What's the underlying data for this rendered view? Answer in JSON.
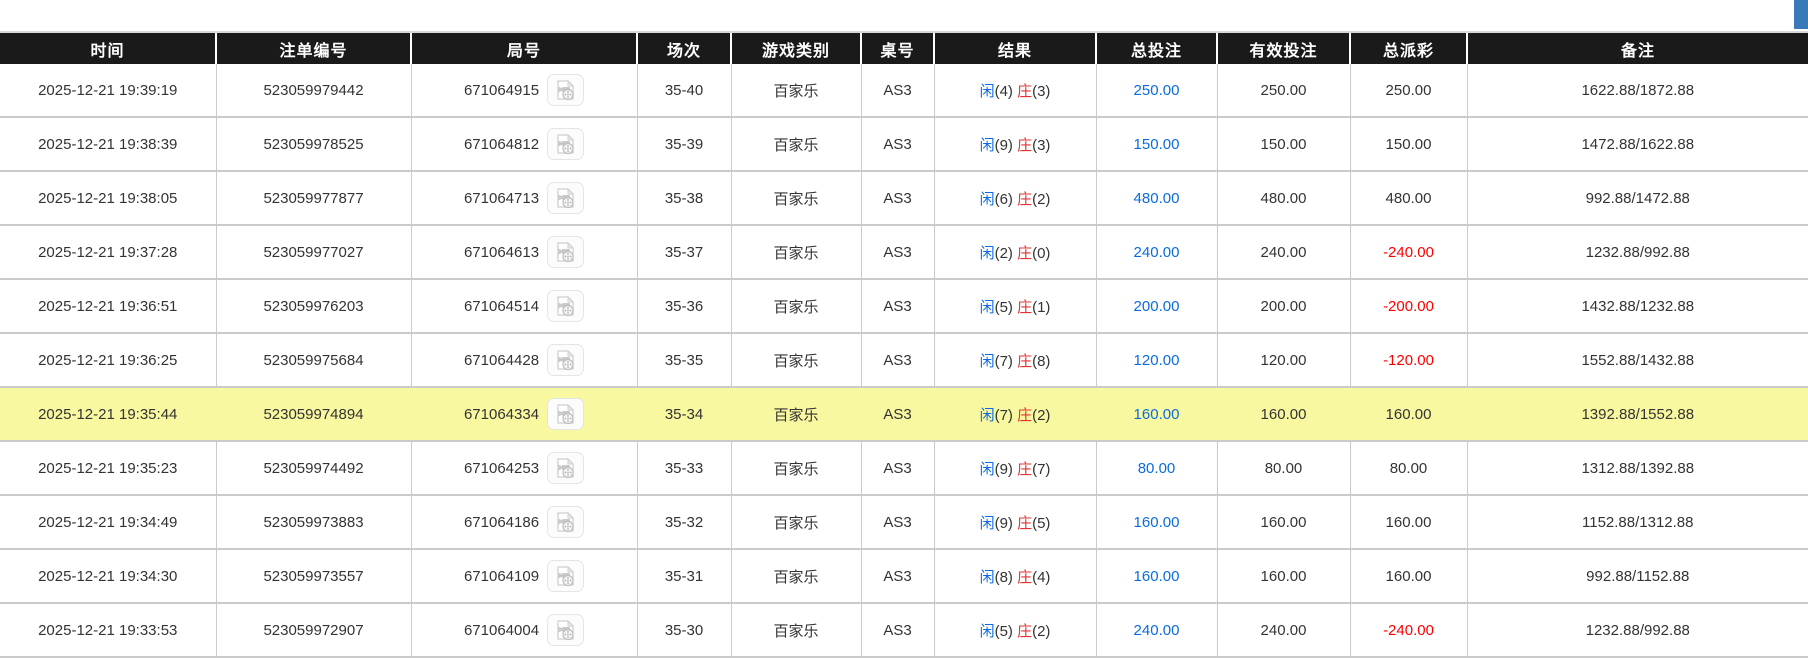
{
  "page": {
    "top_right_fragment": {
      "description": "partially visible blue element at top-right corner",
      "color": "#3a79b8"
    }
  },
  "table": {
    "columns": [
      {
        "key": "time",
        "label": "时间"
      },
      {
        "key": "bet_id",
        "label": "注单编号"
      },
      {
        "key": "round_id",
        "label": "局号"
      },
      {
        "key": "session",
        "label": "场次"
      },
      {
        "key": "game_type",
        "label": "游戏类别"
      },
      {
        "key": "table_no",
        "label": "桌号"
      },
      {
        "key": "result",
        "label": "结果"
      },
      {
        "key": "total_bet",
        "label": "总投注"
      },
      {
        "key": "valid_bet",
        "label": "有效投注"
      },
      {
        "key": "total_payout",
        "label": "总派彩"
      },
      {
        "key": "remark",
        "label": "备注"
      }
    ],
    "labels": {
      "player": "闲",
      "banker": "庄"
    },
    "icons": {
      "round_video": "video-replay-icon"
    },
    "colors": {
      "header_bg": "#1a1a1a",
      "player_blue": "#0a6ce0",
      "banker_red": "#e23333",
      "bet_amount_blue": "#0a6ce0",
      "negative_red": "#ff0000",
      "highlight_yellow": "#f8f8a0",
      "accent_blue": "#3a79b8"
    },
    "rows": [
      {
        "time": "2025-12-21 19:39:19",
        "bet_id": "523059979442",
        "round_id": "671064915",
        "session": "35-40",
        "game_type": "百家乐",
        "table_no": "AS3",
        "player_score": 4,
        "banker_score": 3,
        "total_bet": "250.00",
        "valid_bet": "250.00",
        "total_payout": "250.00",
        "payout_negative": false,
        "remark": "1622.88/1872.88",
        "highlighted": false
      },
      {
        "time": "2025-12-21 19:38:39",
        "bet_id": "523059978525",
        "round_id": "671064812",
        "session": "35-39",
        "game_type": "百家乐",
        "table_no": "AS3",
        "player_score": 9,
        "banker_score": 3,
        "total_bet": "150.00",
        "valid_bet": "150.00",
        "total_payout": "150.00",
        "payout_negative": false,
        "remark": "1472.88/1622.88",
        "highlighted": false
      },
      {
        "time": "2025-12-21 19:38:05",
        "bet_id": "523059977877",
        "round_id": "671064713",
        "session": "35-38",
        "game_type": "百家乐",
        "table_no": "AS3",
        "player_score": 6,
        "banker_score": 2,
        "total_bet": "480.00",
        "valid_bet": "480.00",
        "total_payout": "480.00",
        "payout_negative": false,
        "remark": "992.88/1472.88",
        "highlighted": false
      },
      {
        "time": "2025-12-21 19:37:28",
        "bet_id": "523059977027",
        "round_id": "671064613",
        "session": "35-37",
        "game_type": "百家乐",
        "table_no": "AS3",
        "player_score": 2,
        "banker_score": 0,
        "total_bet": "240.00",
        "valid_bet": "240.00",
        "total_payout": "-240.00",
        "payout_negative": true,
        "remark": "1232.88/992.88",
        "highlighted": false
      },
      {
        "time": "2025-12-21 19:36:51",
        "bet_id": "523059976203",
        "round_id": "671064514",
        "session": "35-36",
        "game_type": "百家乐",
        "table_no": "AS3",
        "player_score": 5,
        "banker_score": 1,
        "total_bet": "200.00",
        "valid_bet": "200.00",
        "total_payout": "-200.00",
        "payout_negative": true,
        "remark": "1432.88/1232.88",
        "highlighted": false
      },
      {
        "time": "2025-12-21 19:36:25",
        "bet_id": "523059975684",
        "round_id": "671064428",
        "session": "35-35",
        "game_type": "百家乐",
        "table_no": "AS3",
        "player_score": 7,
        "banker_score": 8,
        "total_bet": "120.00",
        "valid_bet": "120.00",
        "total_payout": "-120.00",
        "payout_negative": true,
        "remark": "1552.88/1432.88",
        "highlighted": false
      },
      {
        "time": "2025-12-21 19:35:44",
        "bet_id": "523059974894",
        "round_id": "671064334",
        "session": "35-34",
        "game_type": "百家乐",
        "table_no": "AS3",
        "player_score": 7,
        "banker_score": 2,
        "total_bet": "160.00",
        "valid_bet": "160.00",
        "total_payout": "160.00",
        "payout_negative": false,
        "remark": "1392.88/1552.88",
        "highlighted": true
      },
      {
        "time": "2025-12-21 19:35:23",
        "bet_id": "523059974492",
        "round_id": "671064253",
        "session": "35-33",
        "game_type": "百家乐",
        "table_no": "AS3",
        "player_score": 9,
        "banker_score": 7,
        "total_bet": "80.00",
        "valid_bet": "80.00",
        "total_payout": "80.00",
        "payout_negative": false,
        "remark": "1312.88/1392.88",
        "highlighted": false
      },
      {
        "time": "2025-12-21 19:34:49",
        "bet_id": "523059973883",
        "round_id": "671064186",
        "session": "35-32",
        "game_type": "百家乐",
        "table_no": "AS3",
        "player_score": 9,
        "banker_score": 5,
        "total_bet": "160.00",
        "valid_bet": "160.00",
        "total_payout": "160.00",
        "payout_negative": false,
        "remark": "1152.88/1312.88",
        "highlighted": false
      },
      {
        "time": "2025-12-21 19:34:30",
        "bet_id": "523059973557",
        "round_id": "671064109",
        "session": "35-31",
        "game_type": "百家乐",
        "table_no": "AS3",
        "player_score": 8,
        "banker_score": 4,
        "total_bet": "160.00",
        "valid_bet": "160.00",
        "total_payout": "160.00",
        "payout_negative": false,
        "remark": "992.88/1152.88",
        "highlighted": false
      },
      {
        "time": "2025-12-21 19:33:53",
        "bet_id": "523059972907",
        "round_id": "671064004",
        "session": "35-30",
        "game_type": "百家乐",
        "table_no": "AS3",
        "player_score": 5,
        "banker_score": 2,
        "total_bet": "240.00",
        "valid_bet": "240.00",
        "total_payout": "-240.00",
        "payout_negative": true,
        "remark": "1232.88/992.88",
        "highlighted": false
      }
    ]
  }
}
